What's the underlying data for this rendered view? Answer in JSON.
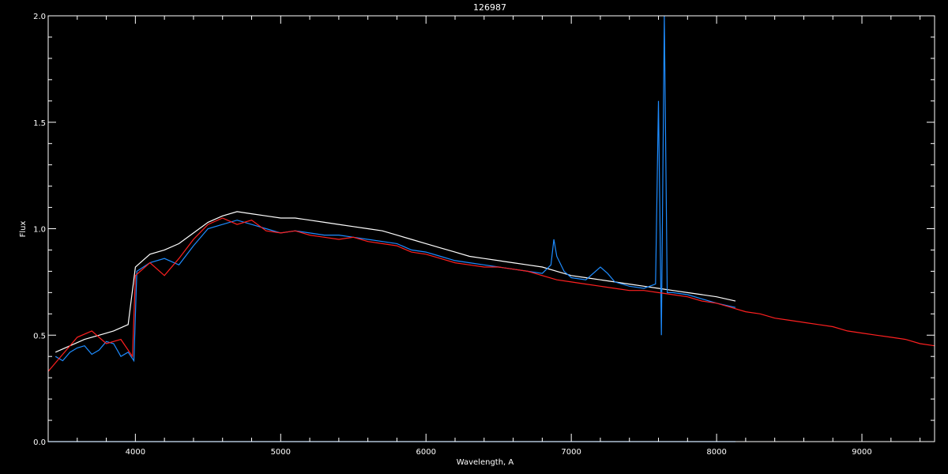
{
  "chart_data": {
    "type": "line",
    "title": "126987",
    "xlabel": "Wavelength, A",
    "ylabel": "Flux",
    "xlim": [
      3400,
      9500
    ],
    "ylim": [
      0.0,
      2.0
    ],
    "x_ticks": [
      4000,
      5000,
      6000,
      7000,
      8000,
      9000
    ],
    "x_tick_labels": [
      "4000",
      "5000",
      "6000",
      "7000",
      "8000",
      "9000"
    ],
    "y_ticks": [
      0.0,
      0.5,
      1.0,
      1.5,
      2.0
    ],
    "y_tick_labels": [
      "0.0",
      "0.5",
      "1.0",
      "1.5",
      "2.0"
    ],
    "grid": false,
    "background": "#000000",
    "foreground": "#ffffff",
    "series": [
      {
        "color": "#ffffff",
        "x": [
          3450,
          3550,
          3650,
          3750,
          3850,
          3950,
          4000,
          4100,
          4200,
          4300,
          4400,
          4500,
          4600,
          4700,
          4800,
          4900,
          5000,
          5100,
          5200,
          5300,
          5400,
          5500,
          5600,
          5700,
          5800,
          5900,
          6000,
          6100,
          6200,
          6300,
          6400,
          6500,
          6600,
          6700,
          6800,
          6900,
          7000,
          7100,
          7200,
          7300,
          7400,
          7500,
          7600,
          7700,
          7800,
          7900,
          8000,
          8130
        ],
        "y": [
          0.42,
          0.45,
          0.48,
          0.5,
          0.52,
          0.55,
          0.82,
          0.88,
          0.9,
          0.93,
          0.98,
          1.03,
          1.06,
          1.08,
          1.07,
          1.06,
          1.05,
          1.05,
          1.04,
          1.03,
          1.02,
          1.01,
          1.0,
          0.99,
          0.97,
          0.95,
          0.93,
          0.91,
          0.89,
          0.87,
          0.86,
          0.85,
          0.84,
          0.83,
          0.82,
          0.8,
          0.78,
          0.77,
          0.76,
          0.75,
          0.74,
          0.73,
          0.72,
          0.71,
          0.7,
          0.69,
          0.68,
          0.66
        ]
      },
      {
        "color": "#1e8cff",
        "x": [
          3450,
          3500,
          3550,
          3600,
          3650,
          3700,
          3750,
          3800,
          3850,
          3900,
          3950,
          3990,
          4010,
          4100,
          4200,
          4300,
          4400,
          4500,
          4600,
          4700,
          4800,
          4900,
          5000,
          5100,
          5200,
          5300,
          5400,
          5500,
          5600,
          5700,
          5800,
          5900,
          6000,
          6100,
          6200,
          6300,
          6400,
          6500,
          6600,
          6700,
          6800,
          6860,
          6880,
          6900,
          6950,
          7000,
          7100,
          7200,
          7250,
          7300,
          7400,
          7500,
          7580,
          7600,
          7620,
          7640,
          7660,
          7700,
          7800,
          7900,
          8000,
          8130
        ],
        "y": [
          0.4,
          0.38,
          0.42,
          0.44,
          0.45,
          0.41,
          0.43,
          0.47,
          0.46,
          0.4,
          0.42,
          0.38,
          0.8,
          0.84,
          0.86,
          0.83,
          0.92,
          1.0,
          1.02,
          1.04,
          1.02,
          1.0,
          0.98,
          0.99,
          0.98,
          0.97,
          0.97,
          0.96,
          0.95,
          0.94,
          0.93,
          0.9,
          0.89,
          0.87,
          0.85,
          0.84,
          0.83,
          0.82,
          0.81,
          0.8,
          0.79,
          0.83,
          0.95,
          0.87,
          0.8,
          0.77,
          0.76,
          0.82,
          0.79,
          0.75,
          0.73,
          0.72,
          0.74,
          1.6,
          0.5,
          2.0,
          0.7,
          0.7,
          0.69,
          0.67,
          0.65,
          0.63
        ]
      },
      {
        "color": "#ff2020",
        "x": [
          3400,
          3500,
          3600,
          3700,
          3800,
          3900,
          3980,
          4000,
          4100,
          4200,
          4300,
          4400,
          4500,
          4600,
          4700,
          4800,
          4900,
          5000,
          5100,
          5200,
          5300,
          5400,
          5500,
          5600,
          5700,
          5800,
          5900,
          6000,
          6100,
          6200,
          6300,
          6400,
          6500,
          6600,
          6700,
          6800,
          6900,
          7000,
          7100,
          7200,
          7300,
          7400,
          7500,
          7600,
          7700,
          7800,
          7900,
          8000,
          8100,
          8200,
          8300,
          8400,
          8500,
          8600,
          8700,
          8800,
          8900,
          9000,
          9100,
          9200,
          9300,
          9400,
          9500
        ],
        "y": [
          0.33,
          0.41,
          0.49,
          0.52,
          0.46,
          0.48,
          0.4,
          0.78,
          0.84,
          0.78,
          0.86,
          0.95,
          1.02,
          1.05,
          1.02,
          1.04,
          0.99,
          0.98,
          0.99,
          0.97,
          0.96,
          0.95,
          0.96,
          0.94,
          0.93,
          0.92,
          0.89,
          0.88,
          0.86,
          0.84,
          0.83,
          0.82,
          0.82,
          0.81,
          0.8,
          0.78,
          0.76,
          0.75,
          0.74,
          0.73,
          0.72,
          0.71,
          0.71,
          0.7,
          0.69,
          0.68,
          0.66,
          0.65,
          0.63,
          0.61,
          0.6,
          0.58,
          0.57,
          0.56,
          0.55,
          0.54,
          0.52,
          0.51,
          0.5,
          0.49,
          0.48,
          0.46,
          0.45
        ]
      },
      {
        "color": "#1e8cff",
        "x": [
          3400,
          8130
        ],
        "y": [
          0.0,
          0.0
        ]
      }
    ]
  }
}
